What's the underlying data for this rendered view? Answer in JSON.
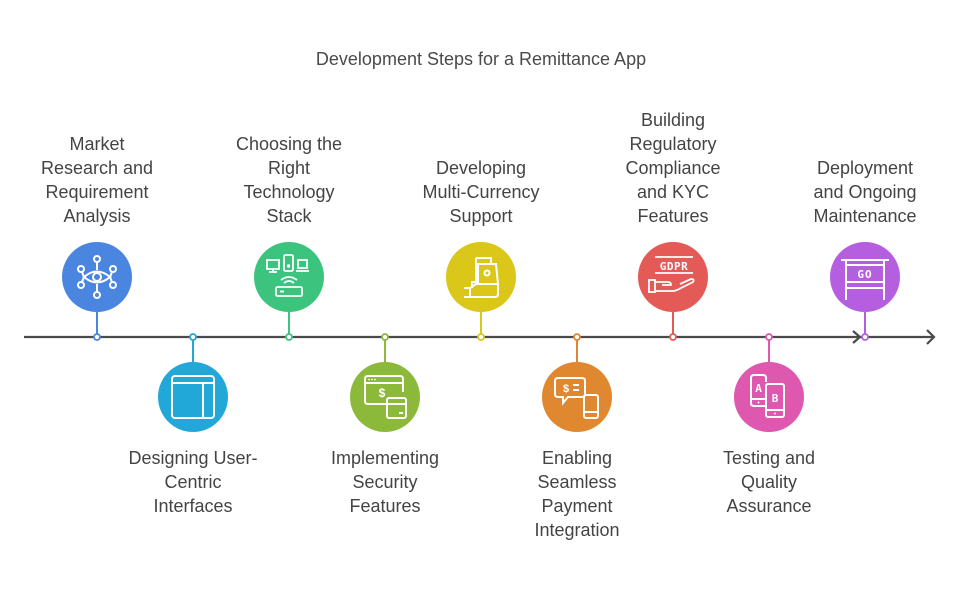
{
  "title": "Development Steps for a Remittance App",
  "steps": [
    {
      "label_lines": [
        "Market",
        "Research and",
        "Requirement",
        "Analysis"
      ],
      "icon": "eye-network-icon",
      "color": "#4a86e0",
      "position": "above"
    },
    {
      "label_lines": [
        "Designing User-",
        "Centric",
        "Interfaces"
      ],
      "icon": "layout-window-icon",
      "color": "#21a8d8",
      "position": "below"
    },
    {
      "label_lines": [
        "Choosing the",
        "Right",
        "Technology",
        "Stack"
      ],
      "icon": "devices-router-icon",
      "color": "#3cc47f",
      "position": "above"
    },
    {
      "label_lines": [
        "Implementing",
        "Security",
        "Features"
      ],
      "icon": "secure-payment-icon",
      "color": "#8db93a",
      "position": "below"
    },
    {
      "label_lines": [
        "Developing",
        "Multi-Currency",
        "Support"
      ],
      "icon": "hand-cash-icon",
      "color": "#dbc61a",
      "position": "above"
    },
    {
      "label_lines": [
        "Enabling",
        "Seamless",
        "Payment",
        "Integration"
      ],
      "icon": "mobile-payment-chat-icon",
      "color": "#e08830",
      "position": "below"
    },
    {
      "label_lines": [
        "Building",
        "Regulatory",
        "Compliance",
        "and KYC",
        "Features"
      ],
      "icon": "gdpr-hand-icon",
      "color": "#e35a56",
      "position": "above"
    },
    {
      "label_lines": [
        "Testing and",
        "Quality",
        "Assurance"
      ],
      "icon": "ab-testing-icon",
      "color": "#dd58ae",
      "position": "below"
    },
    {
      "label_lines": [
        "Deployment",
        "and Ongoing",
        "Maintenance"
      ],
      "icon": "go-sign-icon",
      "color": "#b55fe0",
      "position": "above"
    }
  ],
  "colors": {
    "axis": "#4a4a4a",
    "text": "#444444"
  }
}
